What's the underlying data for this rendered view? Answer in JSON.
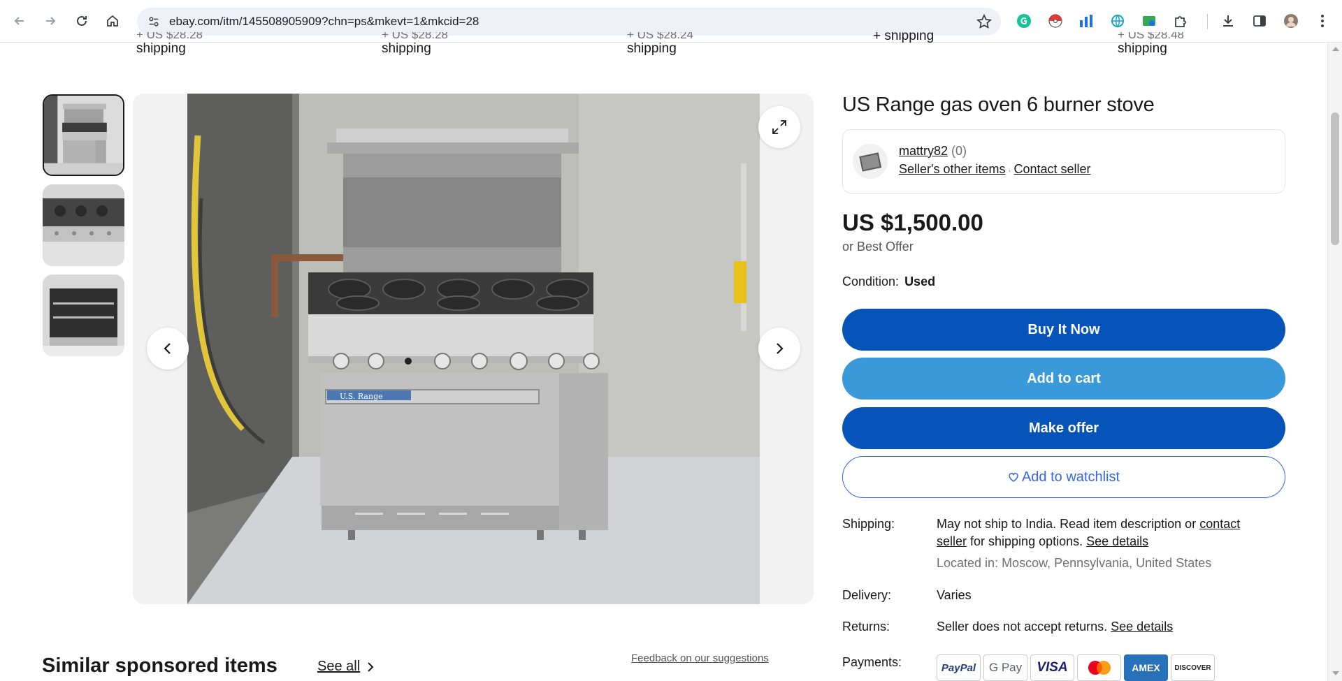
{
  "browser": {
    "url": "ebay.com/itm/145508905909?chn=ps&mkevt=1&mkcid=28"
  },
  "shipping_strip": [
    {
      "cut": "+ US $28.28",
      "label": "shipping"
    },
    {
      "cut": "+ US $28.28",
      "label": "shipping"
    },
    {
      "cut": "+ US $28.24",
      "label": "shipping"
    },
    {
      "cut": "+ shipping",
      "label": ""
    },
    {
      "cut": "+ US $28.48",
      "label": "shipping"
    }
  ],
  "item": {
    "title": "US Range gas oven 6 burner stove",
    "brand_plate": "U.S. Range",
    "seller": {
      "name": "mattry82",
      "feedback_count": "(0)",
      "other_items": "Seller's other items",
      "contact": "Contact seller"
    },
    "price": "US $1,500.00",
    "best_offer": "or Best Offer",
    "condition_label": "Condition:",
    "condition_value": "Used",
    "buttons": {
      "buy_now": "Buy It Now",
      "add_to_cart": "Add to cart",
      "make_offer": "Make offer",
      "watchlist": "Add to watchlist"
    },
    "shipping": {
      "label": "Shipping:",
      "text_before": "May not ship to India. Read item description or ",
      "contact_link": "contact seller",
      "text_after": " for shipping options. ",
      "details_link": "See details",
      "location": "Located in: Moscow, Pennsylvania, United States"
    },
    "delivery": {
      "label": "Delivery:",
      "value": "Varies"
    },
    "returns": {
      "label": "Returns:",
      "value": "Seller does not accept returns. ",
      "details_link": "See details"
    },
    "payments": {
      "label": "Payments:",
      "methods": [
        "PayPal",
        "G Pay",
        "VISA",
        "Mastercard",
        "AMEX",
        "DISCOVER"
      ]
    }
  },
  "similar": {
    "heading": "Similar sponsored items",
    "see_all": "See all",
    "feedback": "Feedback on our suggestions"
  },
  "colors": {
    "primary_button": "#0654ba",
    "secondary_button": "#3a9ad9",
    "link_blue": "#3665f3"
  }
}
